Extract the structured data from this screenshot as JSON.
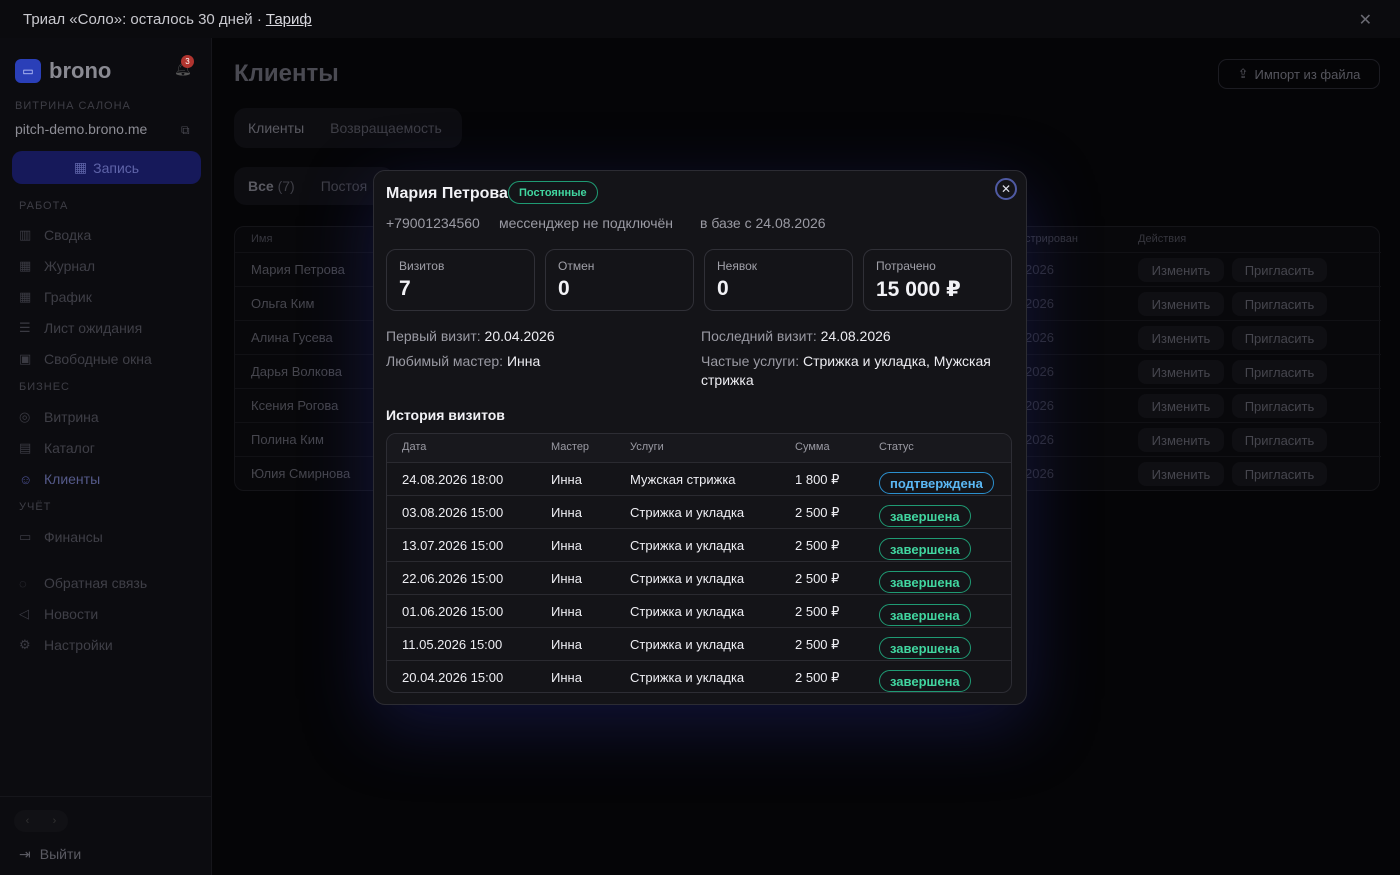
{
  "banner": {
    "text": "Триал «Соло»: осталось 30 дней ·",
    "link": "Тариф"
  },
  "sidebar": {
    "brand": "brono",
    "notifications": "3",
    "storefront_section": "ВИТРИНА САЛОНА",
    "domain": "pitch-demo.brono.me",
    "book_button": "Запись",
    "sections": {
      "work": "РАБОТА",
      "business": "БИЗНЕС",
      "accounting": "УЧЁТ"
    },
    "items": [
      {
        "label": "Сводка"
      },
      {
        "label": "Журнал"
      },
      {
        "label": "График"
      },
      {
        "label": "Лист ожидания"
      },
      {
        "label": "Свободные окна"
      },
      {
        "label": "Витрина"
      },
      {
        "label": "Каталог"
      },
      {
        "label": "Клиенты"
      },
      {
        "label": "Финансы"
      },
      {
        "label": "Обратная связь"
      },
      {
        "label": "Новости"
      },
      {
        "label": "Настройки"
      }
    ],
    "logout": "Выйти"
  },
  "main": {
    "title": "Клиенты",
    "import_button": "Импорт из файла",
    "tabs": [
      "Клиенты",
      "Возвращаемость"
    ],
    "filters": [
      "Все",
      "(7)",
      "Постоя"
    ],
    "table_headers": {
      "name": "Имя",
      "registered": "стрирован",
      "actions": "Действия"
    },
    "rows": [
      {
        "name": "Мария Петрова",
        "date": "2026"
      },
      {
        "name": "Ольга Ким",
        "date": "2026"
      },
      {
        "name": "Алина Гусева",
        "date": "2026"
      },
      {
        "name": "Дарья Волкова",
        "date": "2026"
      },
      {
        "name": "Ксения Рогова",
        "date": "2026"
      },
      {
        "name": "Полина Ким",
        "date": "2026"
      },
      {
        "name": "Юлия Смирнова",
        "date": "2026"
      }
    ],
    "edit_label": "Изменить",
    "invite_label": "Пригласить"
  },
  "modal": {
    "name": "Мария Петрова",
    "segment": "Постоянные",
    "phone": "+79001234560",
    "messenger": "мессенджер не подключён",
    "since": "в базе с 24.08.2026",
    "stats": [
      {
        "label": "Визитов",
        "value": "7"
      },
      {
        "label": "Отмен",
        "value": "0"
      },
      {
        "label": "Неявок",
        "value": "0"
      },
      {
        "label": "Потрачено",
        "value": "15 000 ₽"
      }
    ],
    "first_visit_label": "Первый визит:",
    "first_visit": "20.04.2026",
    "last_visit_label": "Последний визит:",
    "last_visit": "24.08.2026",
    "fav_master_label": "Любимый мастер:",
    "fav_master": "Инна",
    "frequent_label": "Частые услуги:",
    "frequent": "Стрижка и укладка, Мужская стрижка",
    "history_title": "История визитов",
    "history_headers": {
      "date": "Дата",
      "master": "Мастер",
      "services": "Услуги",
      "sum": "Сумма",
      "status": "Статус"
    },
    "history": [
      {
        "date": "24.08.2026 18:00",
        "master": "Инна",
        "service": "Мужская стрижка",
        "sum": "1 800 ₽",
        "status": "подтверждена"
      },
      {
        "date": "03.08.2026 15:00",
        "master": "Инна",
        "service": "Стрижка и укладка",
        "sum": "2 500 ₽",
        "status": "завершена"
      },
      {
        "date": "13.07.2026 15:00",
        "master": "Инна",
        "service": "Стрижка и укладка",
        "sum": "2 500 ₽",
        "status": "завершена"
      },
      {
        "date": "22.06.2026 15:00",
        "master": "Инна",
        "service": "Стрижка и укладка",
        "sum": "2 500 ₽",
        "status": "завершена"
      },
      {
        "date": "01.06.2026 15:00",
        "master": "Инна",
        "service": "Стрижка и укладка",
        "sum": "2 500 ₽",
        "status": "завершена"
      },
      {
        "date": "11.05.2026 15:00",
        "master": "Инна",
        "service": "Стрижка и укладка",
        "sum": "2 500 ₽",
        "status": "завершена"
      },
      {
        "date": "20.04.2026 15:00",
        "master": "Инна",
        "service": "Стрижка и укладка",
        "sum": "2 500 ₽",
        "status": "завершена"
      }
    ]
  },
  "colors": {
    "accent": "#2a3fb8",
    "success": "#41d6a0",
    "info": "#5bb8f5",
    "background": "#050507"
  }
}
